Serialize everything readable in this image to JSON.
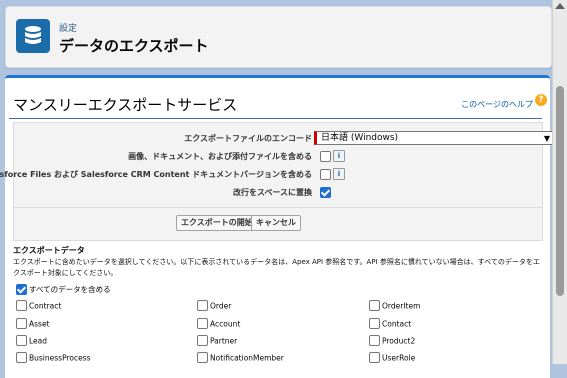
{
  "header": {
    "breadcrumb": "設定",
    "title": "データのエクスポート",
    "icon": "database-icon",
    "icon_bg": "#1b6ca8"
  },
  "main": {
    "title": "マンスリーエクスポートサービス",
    "help_link": "このページのヘルプ",
    "help_icon": "?"
  },
  "form": {
    "encoding_label": "エクスポートファイルのエンコード",
    "encoding_value": "日本語 (Windows)",
    "include_images_label": "画像、ドキュメント、および添付ファイルを含める",
    "include_images_checked": false,
    "include_files_label": "Salesforce Files および Salesforce CRM Content ドキュメントバージョンを含める",
    "include_files_checked": false,
    "replace_crlf_label": "改行をスペースに置換",
    "replace_crlf_checked": true,
    "info_icon_text": "i",
    "start_button": "エクスポートの開始",
    "cancel_button": "キャンセル"
  },
  "export_data": {
    "title": "エクスポートデータ",
    "description": "エクスポートに含めたいデータを選択してください。以下に表示されているデータ名は、Apex API 参照名です。API 参照名に慣れていない場合は、すべてのデータをエクスポート対象にしてください。",
    "include_all_label": "すべてのデータを含める",
    "include_all_checked": true,
    "objects": [
      [
        "Contract",
        "Order",
        "OrderItem"
      ],
      [
        "Asset",
        "Account",
        "Contact"
      ],
      [
        "Lead",
        "Partner",
        "Product2"
      ],
      [
        "BusinessProcess",
        "NotificationMember",
        "UserRole"
      ]
    ]
  },
  "colors": {
    "accent": "#1e78d1",
    "background": "#b0c4df",
    "link": "#015ba7",
    "required": "#cc0000"
  }
}
